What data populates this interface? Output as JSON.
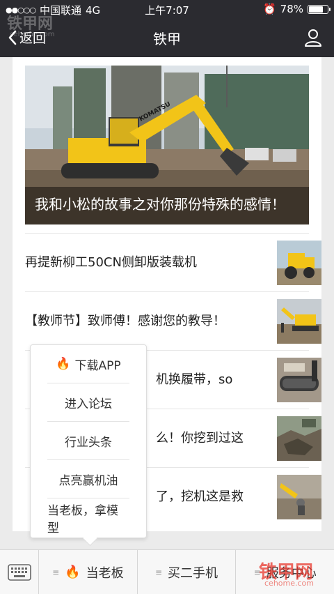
{
  "status_bar": {
    "carrier": "中国联通",
    "network": "4G",
    "time": "上午7:07",
    "battery": "78%",
    "battery_level": 0.78
  },
  "nav": {
    "back_label": "返回",
    "title": "铁甲"
  },
  "hero": {
    "caption": "我和小松的故事之对你那份特殊的感情！",
    "brand_text": "KOMATSU"
  },
  "news": [
    {
      "title": "再提新柳工50CN侧卸版装载机"
    },
    {
      "title": "【教师节】致师傅！感谢您的教导！"
    },
    {
      "title": "机换履带，so"
    },
    {
      "title": "么！你挖到过这"
    },
    {
      "title": "了，挖机这是救"
    }
  ],
  "popup_menu": [
    {
      "label": "下载APP",
      "icon": "fire-icon"
    },
    {
      "label": "进入论坛"
    },
    {
      "label": "行业头条"
    },
    {
      "label": "点亮赢机油"
    },
    {
      "label": "当老板，拿模型"
    }
  ],
  "bottom_tabs": [
    {
      "label": "当老板",
      "icon": "fire-icon"
    },
    {
      "label": "买二手机"
    },
    {
      "label": "服务中心"
    }
  ],
  "watermarks": {
    "top": "铁甲网",
    "top_sub": "cehome.com",
    "bottom": "铁甲网",
    "bottom_sub": "cehome.com"
  },
  "colors": {
    "nav_bg": "#2b2b30",
    "excavator": "#f2c418",
    "watermark": "#e8372c"
  }
}
